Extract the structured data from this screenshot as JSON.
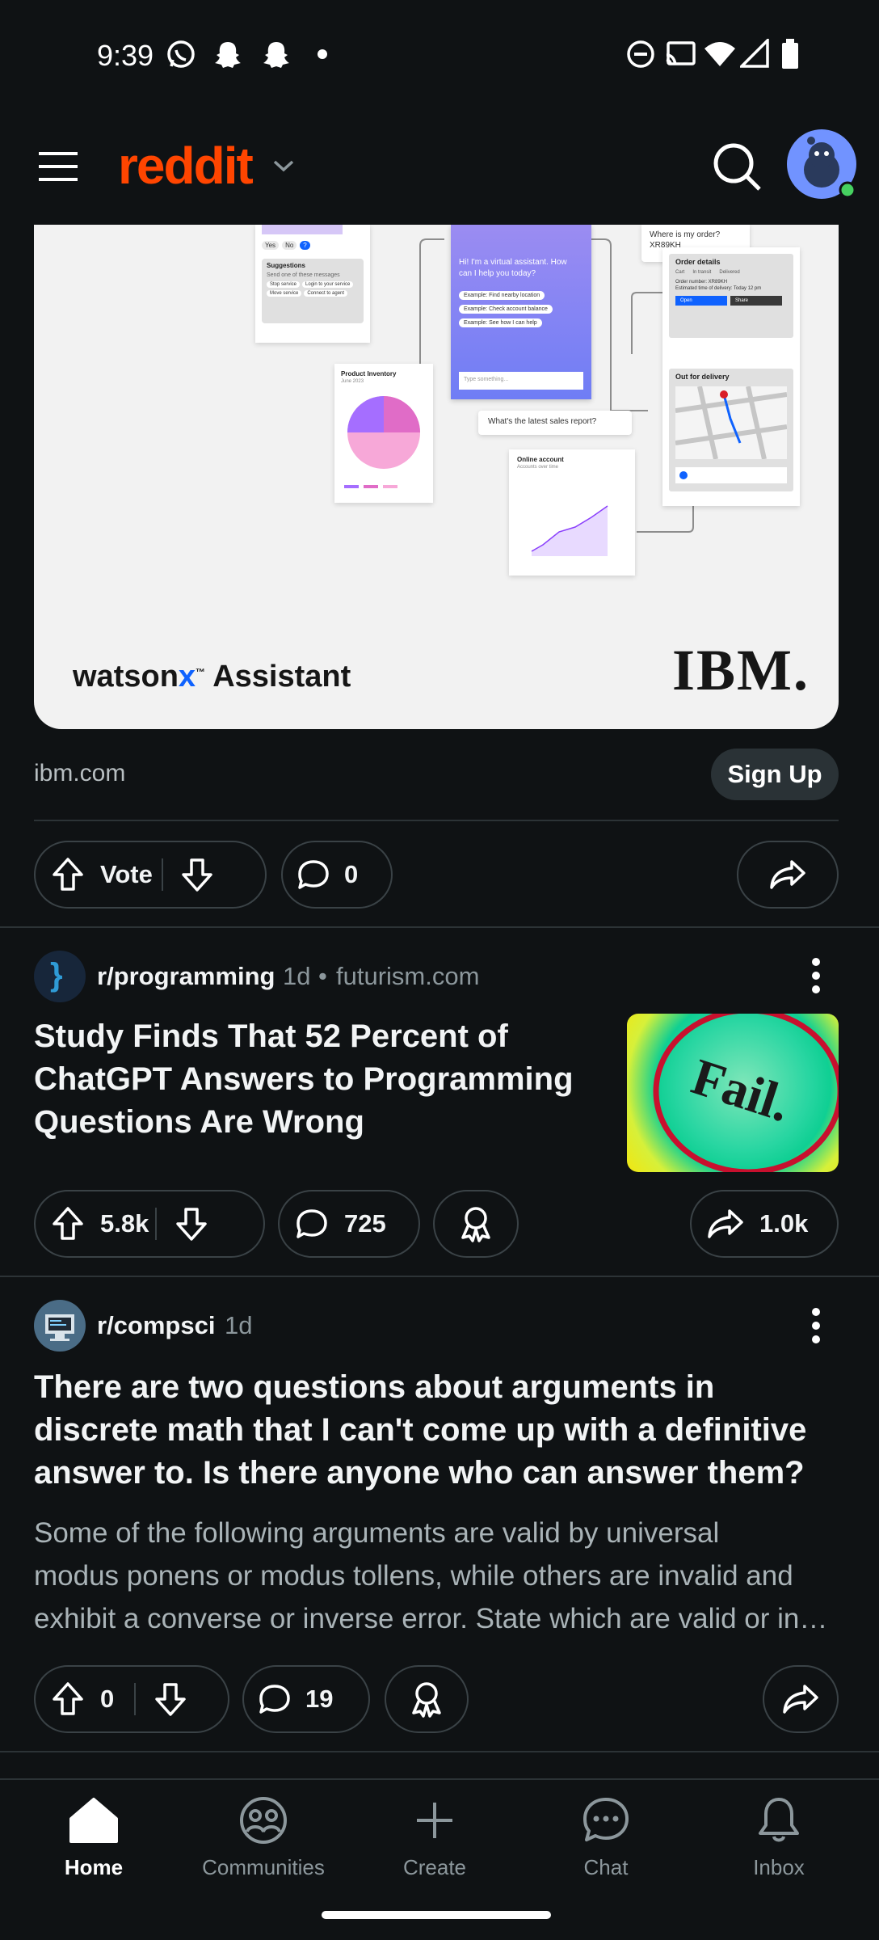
{
  "status_bar": {
    "time": "9:39",
    "icons_left": [
      "whatsapp-icon",
      "snapchat-icon",
      "snapchat-icon",
      "dot-icon"
    ],
    "icons_right": [
      "dnd-icon",
      "cast-icon",
      "wifi-icon",
      "signal-icon",
      "battery-icon"
    ]
  },
  "header": {
    "logo": "reddit",
    "menu_icon": "hamburger-icon",
    "search_icon": "search-icon",
    "avatar_status": "online"
  },
  "ad": {
    "mock": {
      "bubble_order": "Where is my order? XR89KH",
      "assistant_greeting": "Hi! I'm a virtual assistant. How can I help you today?",
      "assistant_options": [
        "Example: Find nearby location",
        "Example: Check account balance",
        "Example: See how I can help"
      ],
      "assistant_input": "Type something...",
      "suggestions_title": "Suggestions",
      "suggestions_sub": "Send one of these messages",
      "suggestions_chips": [
        "Stop service",
        "Login to your service",
        "Move service",
        "Connect to agent"
      ],
      "yes_no": [
        "Yes",
        "No"
      ],
      "order_title": "Order details",
      "order_steps": [
        "Cart",
        "In transit",
        "Delivered"
      ],
      "order_number": "Order number: XR89KH",
      "order_eta": "Estimated time of delivery: Today 12 pm",
      "order_buttons": [
        "Open",
        "Share"
      ],
      "delivery_title": "Out for delivery",
      "inventory_title": "Product Inventory",
      "inventory_date": "June 2023",
      "sales_bubble": "What's the latest sales report?",
      "online_title": "Online account",
      "online_sub": "Accounts over time"
    },
    "brand_prefix": "watson",
    "brand_x": "x",
    "brand_tm": "™",
    "brand_suffix": " Assistant",
    "ibm_logo": "IBM.",
    "domain": "ibm.com",
    "cta": "Sign Up",
    "vote_label": "Vote",
    "comments": "0"
  },
  "posts": [
    {
      "subreddit": "r/programming",
      "age": "1d",
      "separator": "•",
      "source": "futurism.com",
      "title_lines": [
        "Study Finds That 52 Percent of",
        "ChatGPT Answers to Programming",
        "Questions Are Wrong"
      ],
      "thumbnail_text": "Fail.",
      "votes": "5.8k",
      "comments": "725",
      "shares": "1.0k"
    },
    {
      "subreddit": "r/compsci",
      "age": "1d",
      "title_lines": [
        "There are two questions about arguments in",
        "discrete math that I can't come up with a definitive",
        "answer to. Is there anyone who can answer them?"
      ],
      "body_lines": [
        "Some of the following arguments are valid by universal",
        "modus ponens or modus tollens, while others are invalid and",
        "exhibit a converse or inverse error. State which are valid or in…"
      ],
      "votes": "0",
      "comments": "19"
    }
  ],
  "bottom_nav": [
    {
      "label": "Home",
      "icon": "home-icon",
      "active": true
    },
    {
      "label": "Communities",
      "icon": "communities-icon",
      "active": false
    },
    {
      "label": "Create",
      "icon": "plus-icon",
      "active": false
    },
    {
      "label": "Chat",
      "icon": "chat-icon",
      "active": false
    },
    {
      "label": "Inbox",
      "icon": "bell-icon",
      "active": false
    }
  ],
  "colors": {
    "background": "#0f1214",
    "reddit_orange": "#ff4500",
    "muted_text": "#8c979c",
    "pill_border": "#3a4246",
    "ibm_blue": "#0f62fe"
  }
}
